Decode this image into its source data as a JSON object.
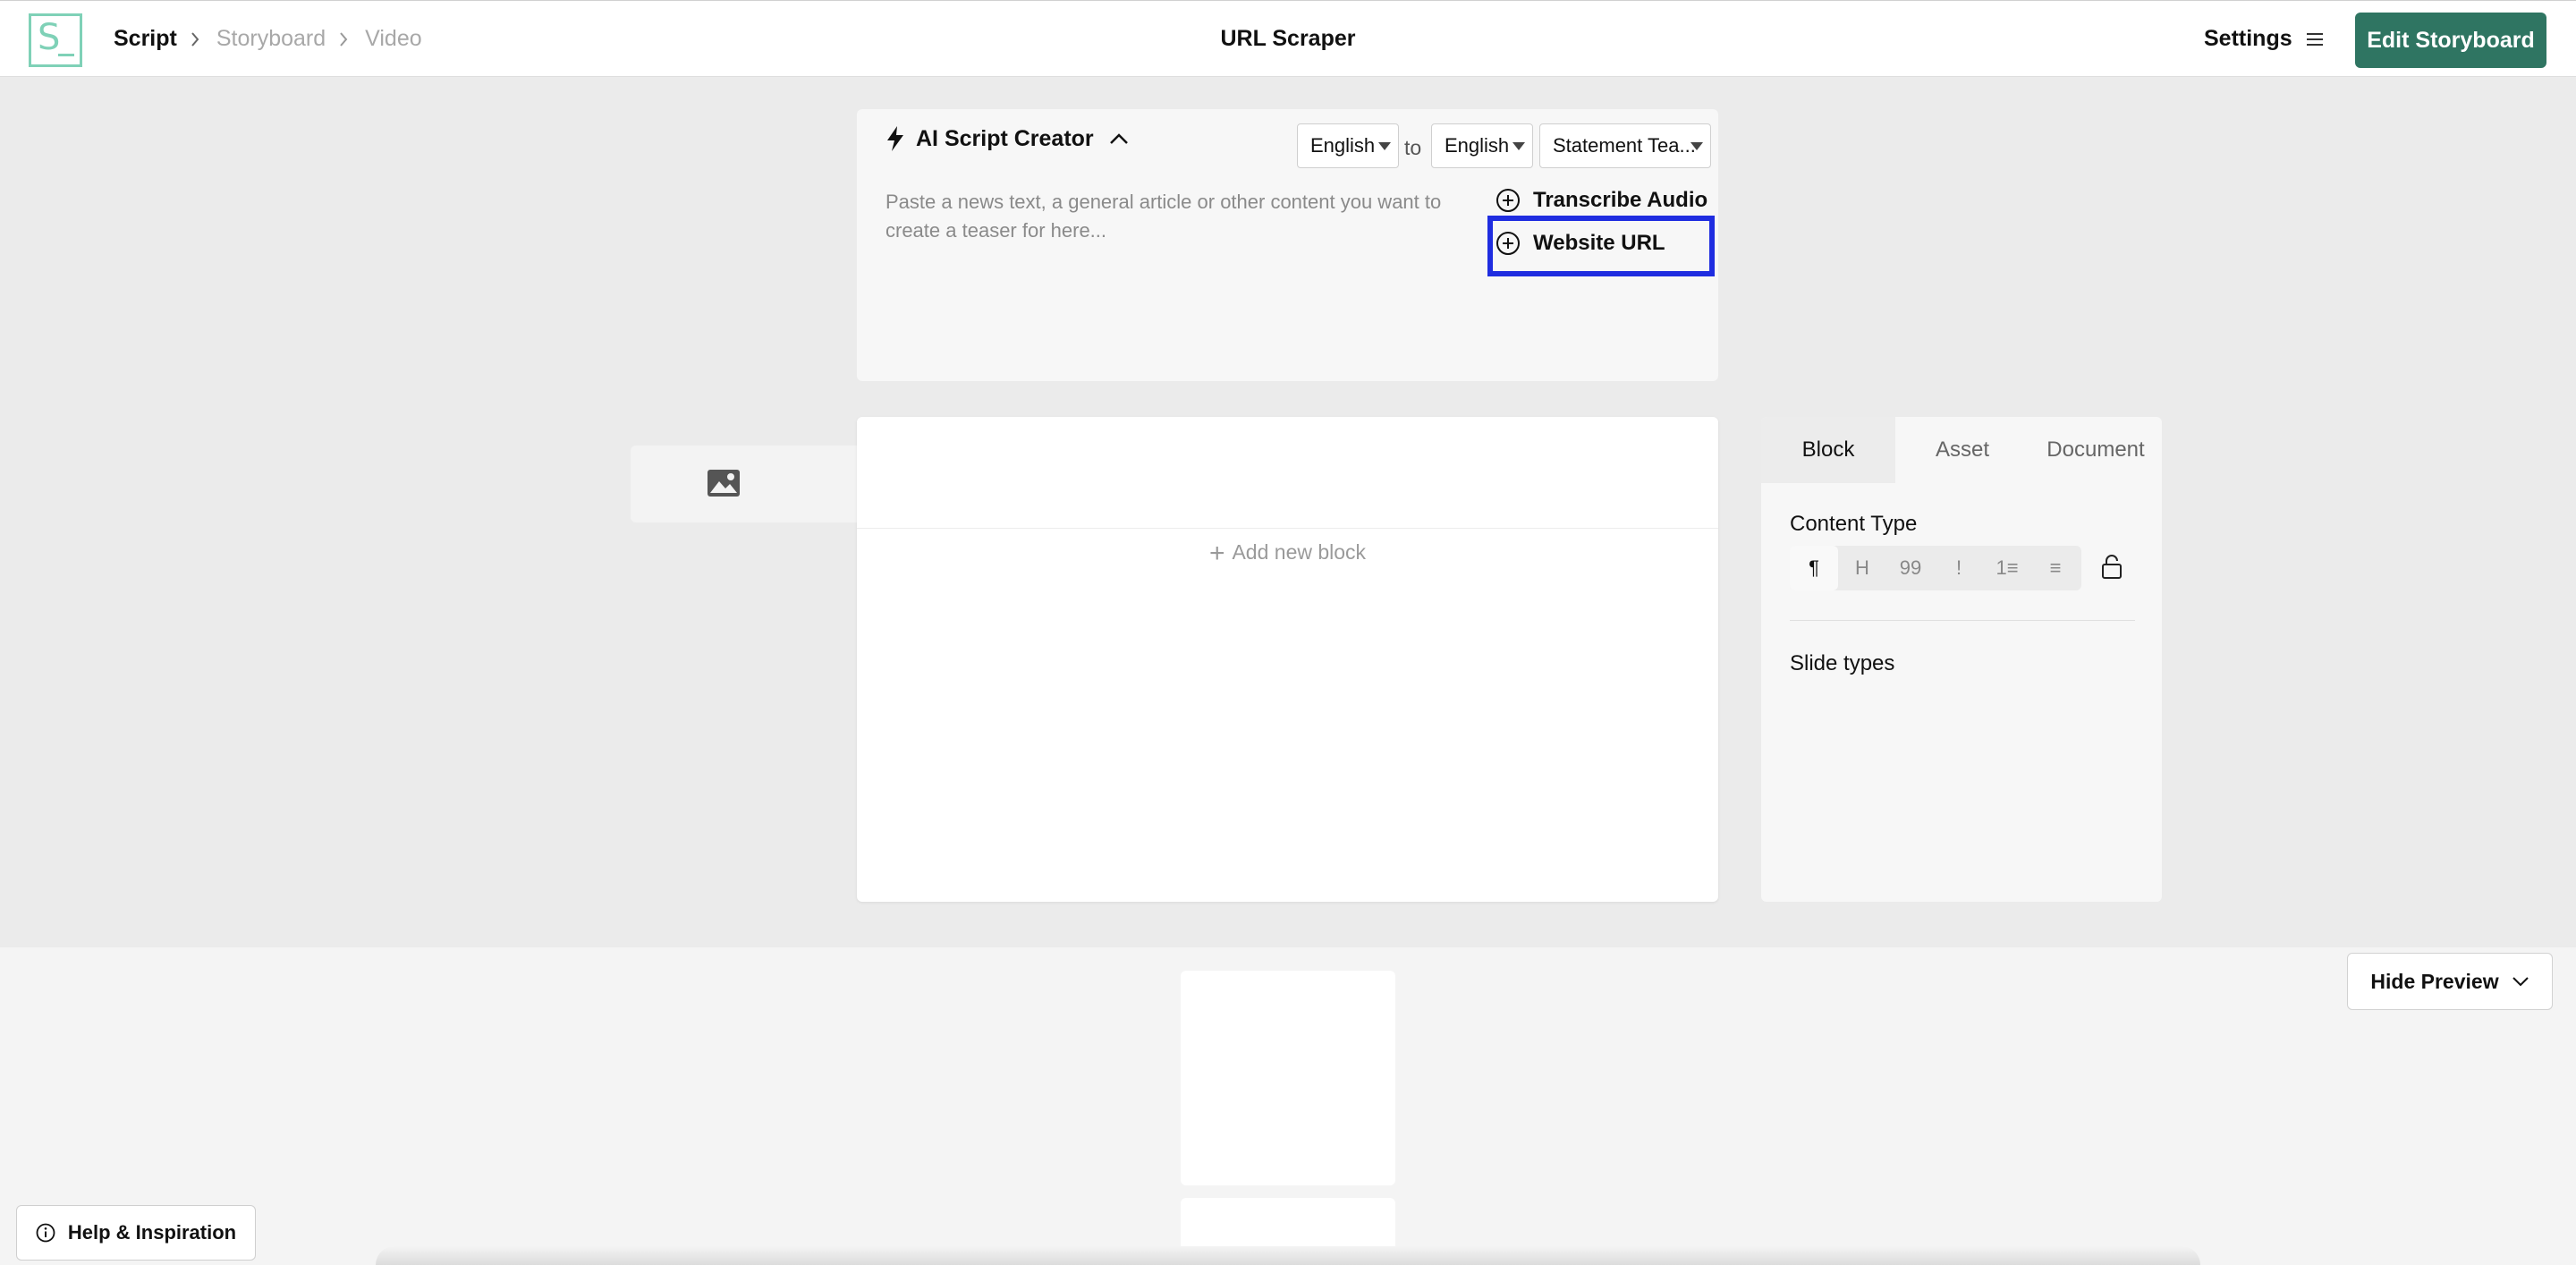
{
  "header": {
    "logo_letter": "S",
    "breadcrumb": [
      "Script",
      "Storyboard",
      "Video"
    ],
    "title": "URL Scraper",
    "settings_label": "Settings",
    "edit_storyboard_label": "Edit Storyboard"
  },
  "ai_creator": {
    "title": "AI Script Creator",
    "source_language": "English",
    "to_label": "to",
    "target_language": "English",
    "style": "Statement Tea...",
    "input_placeholder": "Paste a news text, a general article or other content you want to create a teaser for here...",
    "options": [
      "Transcribe Audio",
      "Website URL"
    ]
  },
  "editor": {
    "add_block_label": "Add new block"
  },
  "panel": {
    "tabs": [
      "Block",
      "Asset",
      "Document"
    ],
    "active_tab": "Block",
    "content_type_label": "Content Type",
    "content_types": [
      "¶",
      "H",
      "99",
      "!",
      "1≡",
      "≡"
    ],
    "slide_types_label": "Slide types"
  },
  "preview": {
    "hide_preview_label": "Hide Preview"
  },
  "help": {
    "label": "Help & Inspiration"
  },
  "colors": {
    "brand": "#2f7562",
    "logo": "#7fd1b7",
    "highlight": "#1f2de0",
    "background": "#ebebeb"
  }
}
